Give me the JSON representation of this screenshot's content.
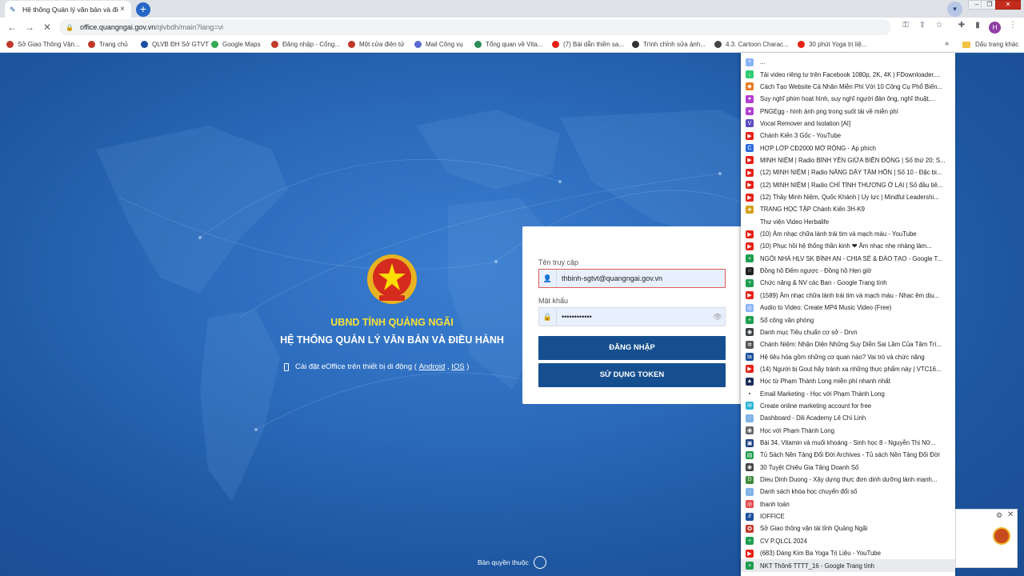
{
  "browser": {
    "tab_title": "Hệ thống Quản lý văn bản và điề",
    "tab_close": "×",
    "new_tab": "+",
    "url_host": "office.quangngai.gov.vn",
    "url_path": "/qlvbdh/main?lang=vi",
    "profile_initial": "H",
    "bookmarks_bar": [
      {
        "label": "Sở Giao Thông Vận...",
        "icon": "seal-icon",
        "color": "#c0392b"
      },
      {
        "label": "Trang chủ",
        "icon": "seal-icon",
        "color": "#c0392b"
      },
      {
        "label": "QLVB ĐH Sở GTVT",
        "icon": "eoffice-icon",
        "color": "#1a4fa0"
      },
      {
        "label": "Google Maps",
        "icon": "map-pin-icon",
        "color": "#34a853"
      },
      {
        "label": "Đăng nhập - Cổng...",
        "icon": "seal-icon",
        "color": "#c0392b"
      },
      {
        "label": "Một cửa điện tử",
        "icon": "seal-icon",
        "color": "#c0392b"
      },
      {
        "label": "Mail Công vụ",
        "icon": "mail-icon",
        "color": "#5b6bd1"
      },
      {
        "label": "Tổng quan về Vita...",
        "icon": "gear-icon",
        "color": "#2e8b57"
      },
      {
        "label": "(7) Bài dẫn thiền sa...",
        "icon": "youtube-icon",
        "color": "#e62117"
      },
      {
        "label": "Trình chỉnh sửa ảnh...",
        "icon": "image-icon",
        "color": "#333333"
      },
      {
        "label": "4.3. Cartoon Charac...",
        "icon": "globe-icon",
        "color": "#444444"
      },
      {
        "label": "30 phút Yoga trị liệ...",
        "icon": "youtube-icon",
        "color": "#e62117"
      }
    ],
    "bookmarks_more": "»",
    "other_bookmarks": "Dấu trang khác"
  },
  "login": {
    "org_name": "UBND TỈNH QUẢNG NGÃI",
    "system_name": "HỆ THỐNG QUẢN LÝ VĂN BẢN VÀ ĐIỀU HÀNH",
    "mobile_prefix": "Cài đặt eOffice trên thiết bị di động (",
    "android": "Android",
    "separator": ",",
    "ios": "IOS",
    "mobile_suffix": ")",
    "username_label": "Tên truy cập",
    "username_value": "thbinh-sgtvt@quangngai.gov.vn",
    "password_label": "Mật khẩu",
    "password_value": "••••••••••••",
    "login_button": "ĐĂNG NHẬP",
    "token_button": "SỬ DỤNG TOKEN",
    "copyright": "Bản quyền thuộc"
  },
  "bookmark_menu": [
    {
      "label": "...",
      "color": "#8ab4f8",
      "glyph": "•"
    },
    {
      "label": "Tải video riêng tư trên Facebook 1080p, 2K, 4K | FDownloader....",
      "color": "#2ecc71",
      "glyph": "↓"
    },
    {
      "label": "Cách Tạo Website Cá Nhân Miễn Phí Với 10 Công Cụ Phổ Biến...",
      "color": "#e67e22",
      "glyph": "◆"
    },
    {
      "label": "Suy nghĩ phim hoạt hình, suy nghĩ người đàn ông, nghĩ thuật,...",
      "color": "#b03fd1",
      "glyph": "●"
    },
    {
      "label": "PNGEgg - hình ảnh png trong suốt tải về miễn phí",
      "color": "#b03fd1",
      "glyph": "●"
    },
    {
      "label": "Vocal Remover and Isolation [AI]",
      "color": "#5b4bc4",
      "glyph": "V"
    },
    {
      "label": "Chánh Kiến 3 Gốc - YouTube",
      "color": "#e62117",
      "glyph": "▶"
    },
    {
      "label": "HỢP LỚP CĐ2000 MỞ RỘNG - Áp phích",
      "color": "#2d6be0",
      "glyph": "C"
    },
    {
      "label": "MINH NIỆM | Radio BÌNH YÊN GIỮA BIẾN ĐỘNG | Số thứ 20: S...",
      "color": "#e62117",
      "glyph": "▶"
    },
    {
      "label": "(12) MINH NIỆM | Radio NÂNG DẬY TÂM HỒN | Số 10 - Đặc bi...",
      "color": "#e62117",
      "glyph": "▶"
    },
    {
      "label": "(12) MINH NIỆM | Radio CHỈ TÌNH THƯƠNG Ở LẠI | Số đầu tiê...",
      "color": "#e62117",
      "glyph": "▶"
    },
    {
      "label": "(12) Thầy Minh Niệm, Quốc Khánh | Uy lực | Mindful Leadershi...",
      "color": "#e62117",
      "glyph": "▶"
    },
    {
      "label": "TRANG HỌC TẬP Chánh Kiến 3H-K9",
      "color": "#d4a017",
      "glyph": "★"
    },
    {
      "label": "Thư viện Video Herbalife",
      "color": "#ffffff",
      "glyph": ""
    },
    {
      "label": "(10) Âm nhạc chữa lành trái tim và mạch máu - YouTube",
      "color": "#e62117",
      "glyph": "▶"
    },
    {
      "label": "(10) Phục hồi hệ thống thần kinh ❤ Âm nhạc nhẹ nhàng làm...",
      "color": "#e62117",
      "glyph": "▶"
    },
    {
      "label": "NGÔI NHÀ HLV SK BÌNH AN - CHIA SẺ & ĐÀO TẠO - Google T...",
      "color": "#1e9e4f",
      "glyph": "+"
    },
    {
      "label": "Đồng hồ Đếm ngược - Đồng hồ Hẹn giờ",
      "color": "#222222",
      "glyph": "○"
    },
    {
      "label": "Chức năng & NV các Ban - Google Trang tính",
      "color": "#1e9e4f",
      "glyph": "+"
    },
    {
      "label": "(1589) Âm nhạc chữa lành trái tim và mạch máu - Nhạc êm dịu...",
      "color": "#e62117",
      "glyph": "▶"
    },
    {
      "label": "Audio to Video: Create MP4 Music Video (Free)",
      "color": "#8ab4f8",
      "glyph": "◎"
    },
    {
      "label": "Sổ công văn phòng",
      "color": "#1e9e4f",
      "glyph": "+"
    },
    {
      "label": "Danh mục Tiêu chuẩn cơ sở - Drvn",
      "color": "#3c4043",
      "glyph": "◉"
    },
    {
      "label": "Chánh Niệm: Nhận Diện Những Suy Diễn Sai Lầm Của Tâm Trí...",
      "color": "#555555",
      "glyph": "✲"
    },
    {
      "label": "Hệ tiêu hóa gồm những cơ quan nào? Vai trò và chức năng",
      "color": "#1a4fa0",
      "glyph": "ta"
    },
    {
      "label": "(14) Người bị Gout hãy tránh xa những thực phẩm này | VTC16...",
      "color": "#e62117",
      "glyph": "▶"
    },
    {
      "label": "Học từ Phạm Thành Long miễn phí nhanh nhất",
      "color": "#1a2e5a",
      "glyph": "▲"
    },
    {
      "label": "Email Marketing - Học với Phạm Thành Long",
      "color": "#ffffff",
      "glyph": "▪"
    },
    {
      "label": "Create online marketing account for free",
      "color": "#2ab5d6",
      "glyph": "✉"
    },
    {
      "label": "Dashboard - Dili Academy Lê Chí Linh",
      "color": "#7fb3e6",
      "glyph": "◌"
    },
    {
      "label": "Học với Phạm Thành Long",
      "color": "#666666",
      "glyph": "◉"
    },
    {
      "label": "Bài 34. Vitamin và muối khoáng - Sinh học 8 - Nguyễn Thị Nữ...",
      "color": "#1a3f80",
      "glyph": "▣"
    },
    {
      "label": "Tủ Sách Nền Tảng Đổi Đời Archives - Tủ sách Nền Tảng Đổi Đời",
      "color": "#1e9e4f",
      "glyph": "▤"
    },
    {
      "label": "30 Tuyệt Chiêu Gia Tăng Doanh Số",
      "color": "#444444",
      "glyph": "◉"
    },
    {
      "label": "Dieu Dinh Duong - Xây dựng thực đơn dinh dưỡng lành mạnh...",
      "color": "#3c8d3c",
      "glyph": "D"
    },
    {
      "label": "Danh sách khóa học chuyển đổi số",
      "color": "#7fb3e6",
      "glyph": "◌"
    },
    {
      "label": "thanh toán",
      "color": "#e64a4a",
      "glyph": "◎"
    },
    {
      "label": "IOFFICE",
      "color": "#1a4fa0",
      "glyph": "∂"
    },
    {
      "label": "Sở Giao thông vận tải tỉnh Quảng Ngãi",
      "color": "#c0392b",
      "glyph": "✪"
    },
    {
      "label": "CV P.QLCL 2024",
      "color": "#1e9e4f",
      "glyph": "+"
    },
    {
      "label": "(683) Dáng Kim Ba Yoga Trị Liệu - YouTube",
      "color": "#e62117",
      "glyph": "▶"
    },
    {
      "label": "NKT Thôn6 TTTT_16 - Google Trang tính",
      "color": "#1e9e4f",
      "glyph": "+"
    }
  ],
  "popup": {
    "gear": "⚙",
    "close": "✕"
  }
}
